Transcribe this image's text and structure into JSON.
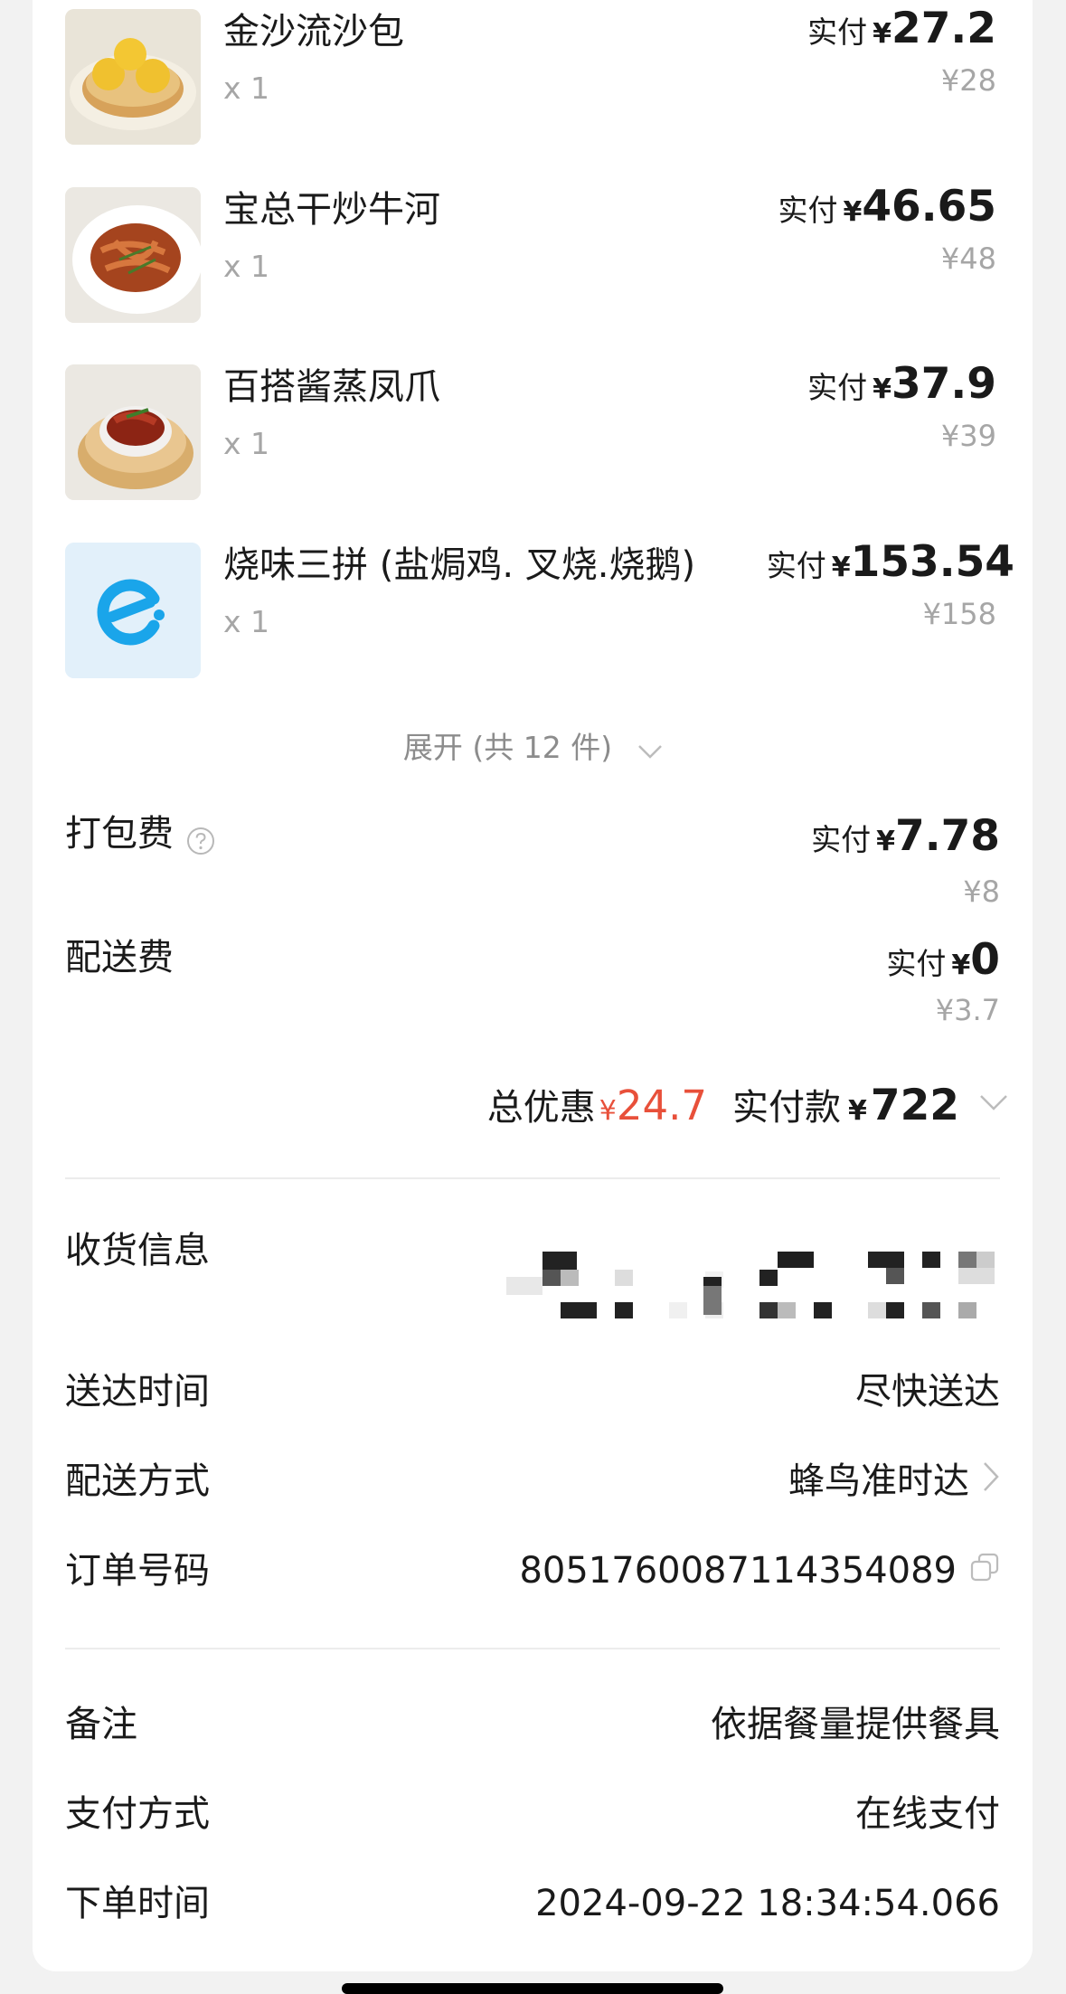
{
  "items": [
    {
      "name": "金沙流沙包",
      "qty": "x 1",
      "pay_label": "实付",
      "currency": "¥",
      "pay_amount": "27.2",
      "original": "¥28",
      "thumb": "gold-buns-image"
    },
    {
      "name": "宝总干炒牛河",
      "qty": "x 1",
      "pay_label": "实付",
      "currency": "¥",
      "pay_amount": "46.65",
      "original": "¥48",
      "thumb": "beef-noodles-image"
    },
    {
      "name": "百搭酱蒸凤爪",
      "qty": "x 1",
      "pay_label": "实付",
      "currency": "¥",
      "pay_amount": "37.9",
      "original": "¥39",
      "thumb": "chicken-feet-image"
    },
    {
      "name": "烧味三拼 (盐焗鸡. 叉烧.烧鹅)",
      "qty": "x 1",
      "pay_label": "实付",
      "currency": "¥",
      "pay_amount": "153.54",
      "original": "¥158",
      "thumb": "eleme-logo"
    }
  ],
  "expand_label": "展开 (共 12 件)",
  "fees": {
    "packing": {
      "label": "打包费",
      "pay_label": "实付",
      "currency": "¥",
      "pay_amount": "7.78",
      "original": "¥8"
    },
    "delivery": {
      "label": "配送费",
      "pay_label": "实付",
      "currency": "¥",
      "pay_amount": "0",
      "original": "¥3.7"
    }
  },
  "totals": {
    "discount_label": "总优惠",
    "discount_currency": "¥",
    "discount_amount": "24.7",
    "paid_label": "实付款",
    "paid_currency": "¥",
    "paid_amount": "722"
  },
  "info": {
    "receiver_label": "收货信息",
    "delivery_time_label": "送达时间",
    "delivery_time_value": "尽快送达",
    "delivery_method_label": "配送方式",
    "delivery_method_value": "蜂鸟准时达",
    "order_no_label": "订单号码",
    "order_no_value": "8051760087114354089",
    "remark_label": "备注",
    "remark_value": "依据餐量提供餐具",
    "payment_label": "支付方式",
    "payment_value": "在线支付",
    "order_time_label": "下单时间",
    "order_time_value": "2024-09-22 18:34:54.066"
  },
  "colors": {
    "accent_red": "#e8503a",
    "eleme_blue": "#1aa5ea",
    "muted": "#a6a6a6"
  }
}
